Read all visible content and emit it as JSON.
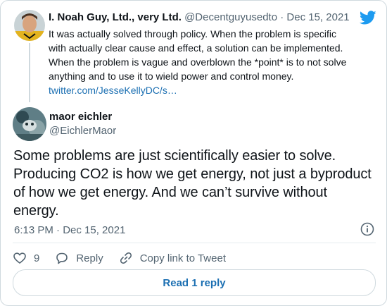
{
  "parent_tweet": {
    "display_name": "I. Noah Guy, Ltd., very Ltd.",
    "handle": "@Decentguyusedto",
    "separator": "·",
    "date": "Dec 15, 2021",
    "text_lines": [
      "It was actually solved through policy. When the problem is specific",
      "with actually clear cause and effect, a solution can be implemented.",
      "When the problem is vague and overblown the *point* is to not solve",
      "anything and to use it to wield power and control money."
    ],
    "link_text": "twitter.com/JesseKellyDC/s…"
  },
  "main_tweet": {
    "display_name": "maor eichler",
    "handle": "@EichlerMaor",
    "text_lines": [
      "Some problems are just scientifically easier to solve.",
      "Producing CO2 is how we get energy, not just a byproduct",
      "of how we get energy. And we can’t survive without",
      "energy."
    ],
    "timestamp": "6:13 PM · Dec 15, 2021"
  },
  "actions": {
    "like_count": "9",
    "reply_label": "Reply",
    "copy_link_label": "Copy link to Tweet"
  },
  "read_replies_label": "Read 1 reply",
  "colors": {
    "brand_blue": "#1d9bf0",
    "link_blue": "#1b6fb2",
    "muted_text": "#536471",
    "border": "#cfd9de"
  },
  "icons": [
    "twitter-bird-icon",
    "info-icon",
    "heart-icon",
    "reply-bubble-icon",
    "link-icon"
  ]
}
